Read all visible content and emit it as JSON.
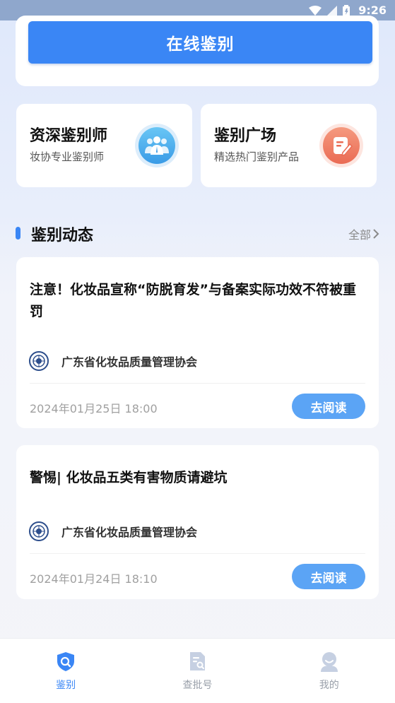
{
  "status_bar": {
    "time": "9:26"
  },
  "top": {
    "primary_button": "在线鉴别"
  },
  "features": [
    {
      "title": "资深鉴别师",
      "subtitle": "妆协专业鉴别师",
      "icon": "experts-group-icon"
    },
    {
      "title": "鉴别广场",
      "subtitle": "精选热门鉴别产品",
      "icon": "note-edit-icon"
    }
  ],
  "section": {
    "title": "鉴别动态",
    "more_label": "全部"
  },
  "news": [
    {
      "title": "注意！化妆品宣称“防脱育发”与备案实际功效不符被重罚",
      "source": "广东省化妆品质量管理协会",
      "date": "2024年01月25日 18:00",
      "action": "去阅读"
    },
    {
      "title": "警惕| 化妆品五类有害物质请避坑",
      "source": "广东省化妆品质量管理协会",
      "date": "2024年01月24日 18:10",
      "action": "去阅读"
    }
  ],
  "bottom_nav": [
    {
      "label": "鉴别",
      "icon": "shield-search-icon",
      "active": true
    },
    {
      "label": "查批号",
      "icon": "document-search-icon",
      "active": false
    },
    {
      "label": "我的",
      "icon": "user-icon",
      "active": false
    }
  ],
  "colors": {
    "accent": "#3a86f5",
    "button_light": "#5ba4f5"
  }
}
